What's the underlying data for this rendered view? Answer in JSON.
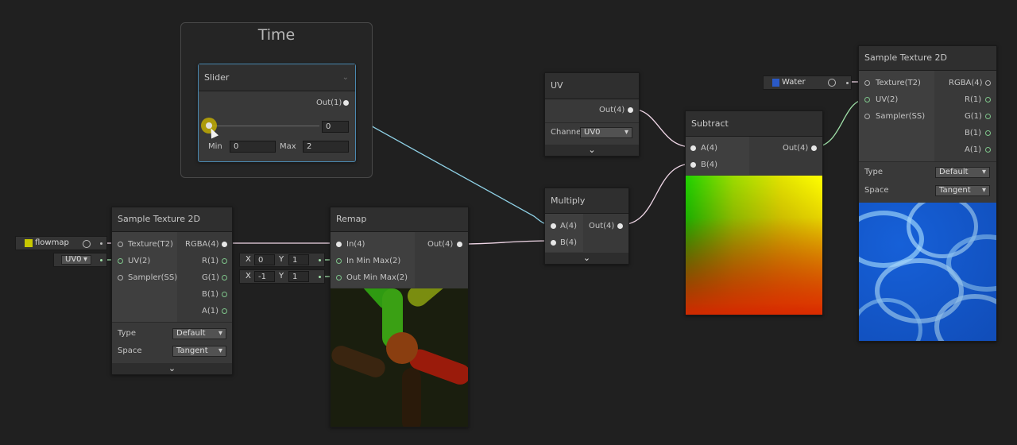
{
  "group": {
    "title": "Time"
  },
  "slider_node": {
    "title": "Slider",
    "output": "Out(1)",
    "value": "0",
    "min_label": "Min",
    "min_value": "0",
    "max_label": "Max",
    "max_value": "2",
    "level": 0
  },
  "uv_node": {
    "title": "UV",
    "output": "Out(4)",
    "channel_label": "Channe",
    "channel_value": "UV0"
  },
  "multiply_node": {
    "title": "Multiply",
    "inputs": [
      "A(4)",
      "B(4)"
    ],
    "output": "Out(4)"
  },
  "subtract_node": {
    "title": "Subtract",
    "inputs": [
      "A(4)",
      "B(4)"
    ],
    "output": "Out(4)"
  },
  "remap_node": {
    "title": "Remap",
    "inputs": [
      "In(4)",
      "In Min Max(2)",
      "Out Min Max(2)"
    ],
    "output": "Out(4)",
    "in_min_max": {
      "x_label": "X",
      "x": "0",
      "y_label": "Y",
      "y": "1"
    },
    "out_min_max": {
      "x_label": "X",
      "x": "-1",
      "y_label": "Y",
      "y": "1"
    }
  },
  "sample_left": {
    "title": "Sample Texture 2D",
    "inputs": [
      "Texture(T2)",
      "UV(2)",
      "Sampler(SS)"
    ],
    "outputs": [
      "RGBA(4)",
      "R(1)",
      "G(1)",
      "B(1)",
      "A(1)"
    ],
    "type_label": "Type",
    "type_value": "Default",
    "space_label": "Space",
    "space_value": "Tangent",
    "texture_chip": "flowmap",
    "uv_chip": "UV0"
  },
  "sample_right": {
    "title": "Sample Texture 2D",
    "inputs": [
      "Texture(T2)",
      "UV(2)",
      "Sampler(SS)"
    ],
    "outputs": [
      "RGBA(4)",
      "R(1)",
      "G(1)",
      "B(1)",
      "A(1)"
    ],
    "type_label": "Type",
    "type_value": "Default",
    "space_label": "Space",
    "space_value": "Tangent",
    "texture_chip": "Water"
  },
  "colors": {
    "background": "#202020",
    "node": "#393939",
    "header": "#2f2f2f",
    "wire_white": "#e8cfe0",
    "wire_blue": "#8fd1e6",
    "wire_green": "#9fe0a8",
    "slider_handle": "#c8b400"
  },
  "icons": {
    "collapse": "chevron-down-icon",
    "target": "target-icon",
    "texture": "texture-icon"
  }
}
